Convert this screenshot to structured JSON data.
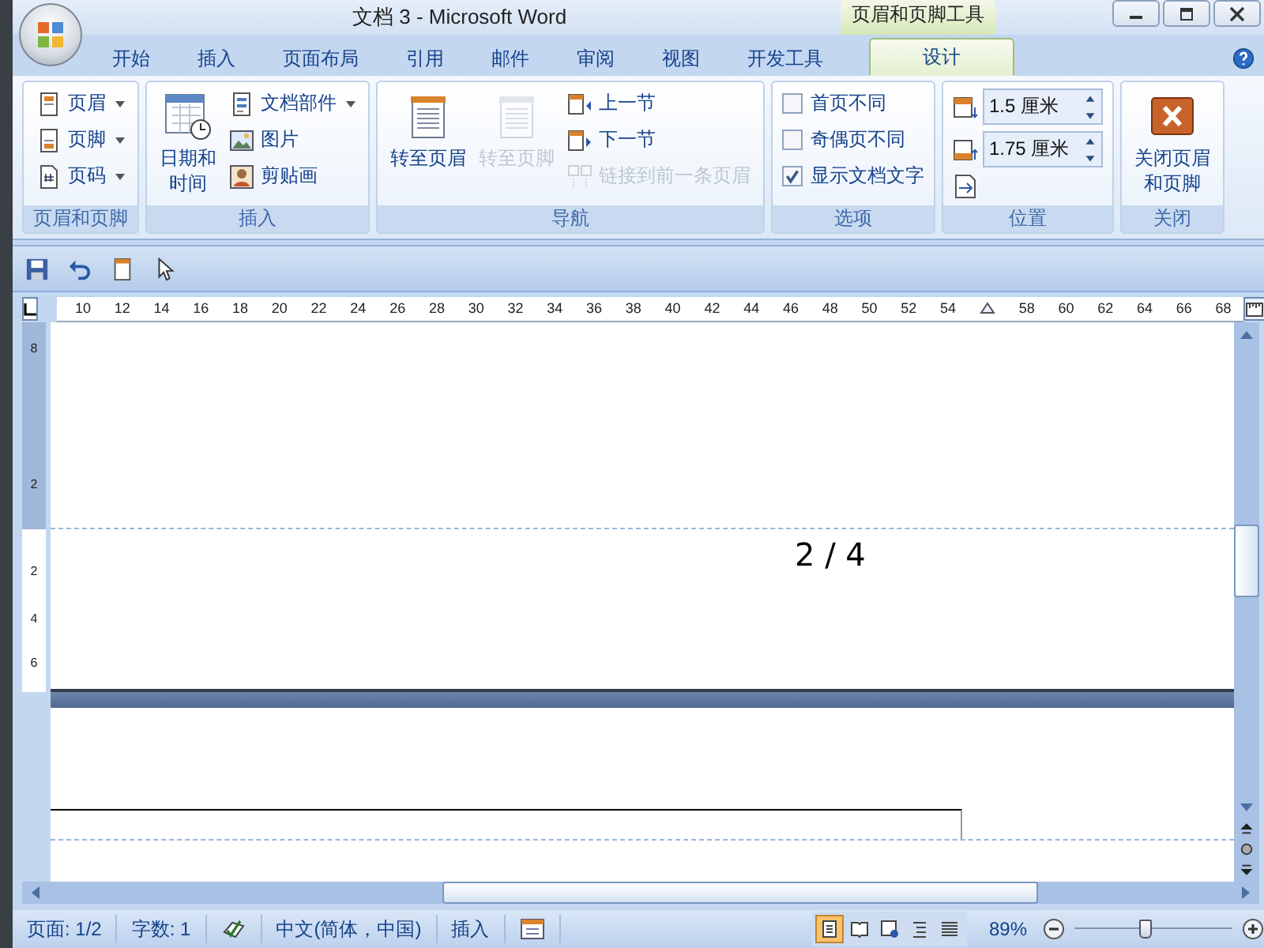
{
  "window": {
    "title": "文档 3 - Microsoft Word",
    "context_tools": "页眉和页脚工具"
  },
  "tabs": [
    {
      "label": "开始",
      "selected": false,
      "kind": "normal"
    },
    {
      "label": "插入",
      "selected": false,
      "kind": "normal"
    },
    {
      "label": "页面布局",
      "selected": false,
      "kind": "normal"
    },
    {
      "label": "引用",
      "selected": false,
      "kind": "normal"
    },
    {
      "label": "邮件",
      "selected": false,
      "kind": "normal"
    },
    {
      "label": "审阅",
      "selected": false,
      "kind": "normal"
    },
    {
      "label": "视图",
      "selected": false,
      "kind": "normal"
    },
    {
      "label": "开发工具",
      "selected": false,
      "kind": "normal"
    },
    {
      "label": "设计",
      "selected": true,
      "kind": "contextual"
    }
  ],
  "ribbon": [
    {
      "label": "页眉和页脚",
      "columns": [
        [
          {
            "kind": "small",
            "label": "页眉",
            "dropdown": true,
            "disabled": false
          },
          {
            "kind": "small",
            "label": "页脚",
            "dropdown": true,
            "disabled": false
          },
          {
            "kind": "small",
            "label": "页码",
            "dropdown": true,
            "disabled": false
          }
        ]
      ]
    },
    {
      "label": "插入",
      "columns": [
        [
          {
            "kind": "large",
            "label": "日期和时间",
            "disabled": false
          }
        ],
        [
          {
            "kind": "small",
            "label": "文档部件",
            "dropdown": true,
            "disabled": false
          },
          {
            "kind": "small",
            "label": "图片",
            "dropdown": false,
            "disabled": false
          },
          {
            "kind": "small",
            "label": "剪贴画",
            "dropdown": false,
            "disabled": false
          }
        ]
      ]
    },
    {
      "label": "导航",
      "columns": [
        [
          {
            "kind": "large",
            "label": "转至页眉",
            "disabled": false
          }
        ],
        [
          {
            "kind": "large",
            "label": "转至页脚",
            "disabled": true
          }
        ],
        [
          {
            "kind": "small",
            "label": "上一节",
            "dropdown": false,
            "disabled": false
          },
          {
            "kind": "small",
            "label": "下一节",
            "dropdown": false,
            "disabled": false
          },
          {
            "kind": "small",
            "label": "链接到前一条页眉",
            "dropdown": false,
            "disabled": true
          }
        ]
      ]
    },
    {
      "label": "选项",
      "columns": [
        [
          {
            "kind": "checkbox",
            "label": "首页不同",
            "checked": false
          },
          {
            "kind": "checkbox",
            "label": "奇偶页不同",
            "checked": false
          },
          {
            "kind": "checkbox",
            "label": "显示文档文字",
            "checked": true
          }
        ]
      ]
    },
    {
      "label": "位置",
      "columns": [
        [
          {
            "kind": "spinner",
            "value": "1.5 厘米"
          },
          {
            "kind": "spinner",
            "value": "1.75 厘米"
          },
          {
            "kind": "icon",
            "disabled": false
          }
        ]
      ]
    },
    {
      "label": "关闭",
      "columns": [
        [
          {
            "kind": "large",
            "label": "关闭页眉和页脚",
            "disabled": false
          }
        ]
      ]
    }
  ],
  "ruler": {
    "marks": [
      {
        "kind": "number",
        "label": "10"
      },
      {
        "kind": "number",
        "label": "12"
      },
      {
        "kind": "number",
        "label": "14"
      },
      {
        "kind": "number",
        "label": "16"
      },
      {
        "kind": "number",
        "label": "18"
      },
      {
        "kind": "number",
        "label": "20"
      },
      {
        "kind": "number",
        "label": "22"
      },
      {
        "kind": "number",
        "label": "24"
      },
      {
        "kind": "number",
        "label": "26"
      },
      {
        "kind": "number",
        "label": "28"
      },
      {
        "kind": "number",
        "label": "30"
      },
      {
        "kind": "number",
        "label": "32"
      },
      {
        "kind": "number",
        "label": "34"
      },
      {
        "kind": "number",
        "label": "36"
      },
      {
        "kind": "number",
        "label": "38"
      },
      {
        "kind": "number",
        "label": "40"
      },
      {
        "kind": "number",
        "label": "42"
      },
      {
        "kind": "number",
        "label": "44"
      },
      {
        "kind": "number",
        "label": "46"
      },
      {
        "kind": "number",
        "label": "48"
      },
      {
        "kind": "number",
        "label": "50"
      },
      {
        "kind": "number",
        "label": "52"
      },
      {
        "kind": "number",
        "label": "54"
      },
      {
        "kind": "indent-marker"
      },
      {
        "kind": "number",
        "label": "58"
      },
      {
        "kind": "number",
        "label": "60"
      },
      {
        "kind": "number",
        "label": "62"
      },
      {
        "kind": "number",
        "label": "64"
      },
      {
        "kind": "number",
        "label": "66"
      },
      {
        "kind": "number",
        "label": "68"
      }
    ],
    "vertical_marks": [
      "8",
      "2",
      "2",
      "4",
      "6"
    ]
  },
  "document": {
    "footer_text": "2 / 4"
  },
  "status_bar": {
    "page": "页面: 1/2",
    "words": "字数: 1",
    "language": "中文(简体，中国)",
    "mode": "插入",
    "views": [
      {
        "selected": true
      },
      {
        "selected": false
      },
      {
        "selected": false
      },
      {
        "selected": false
      },
      {
        "selected": false
      }
    ],
    "zoom": "89%",
    "zoom_slider": {
      "level": 0.45
    }
  }
}
